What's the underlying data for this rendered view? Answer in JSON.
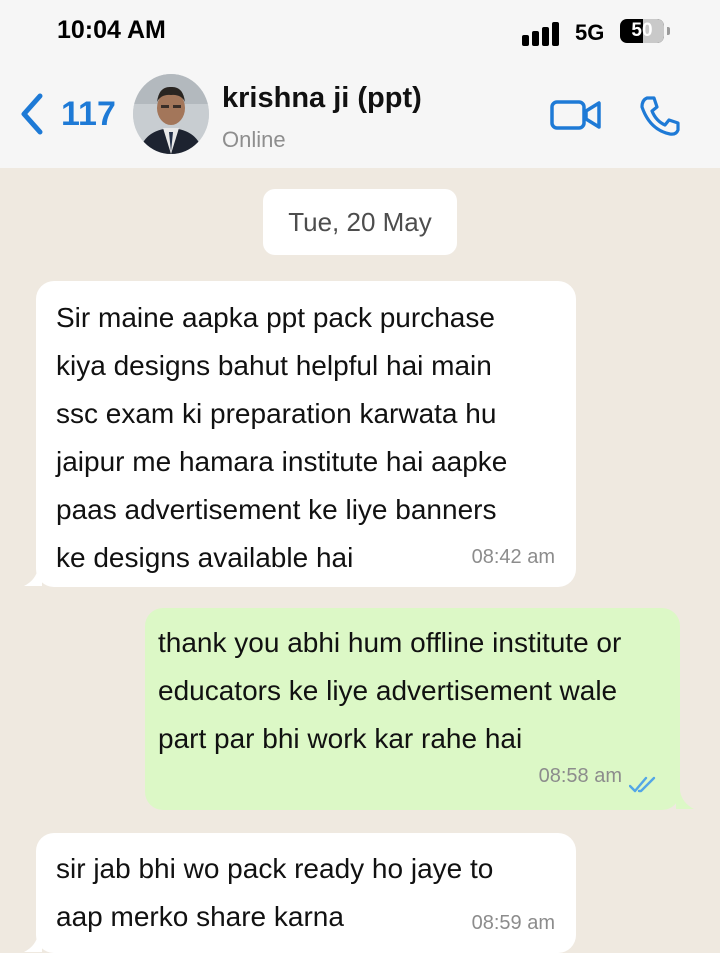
{
  "status_bar": {
    "time": "10:04 AM",
    "network": "5G",
    "battery": "50"
  },
  "header": {
    "back_count": "117",
    "contact_name": "krishna ji (ppt)",
    "contact_status": "Online"
  },
  "chat": {
    "date_chip": "Tue, 20 May",
    "messages": [
      {
        "direction": "incoming",
        "text": "Sir maine aapka ppt pack purchase\nkiya designs bahut helpful hai main\nssc exam ki preparation karwata hu\njaipur me hamara institute hai aapke\npaas advertisement ke liye banners\nke designs available hai",
        "time": "08:42 am"
      },
      {
        "direction": "outgoing",
        "text": "thank you abhi hum offline institute or\neducators ke liye advertisement wale\npart par bhi work kar rahe hai",
        "time": "08:58 am",
        "status_icon": "double-check-read-icon"
      },
      {
        "direction": "incoming",
        "text": "sir jab bhi wo pack ready ho jaye to\naap merko share karna",
        "time": "08:59 am"
      }
    ]
  },
  "colors": {
    "accent": "#1e7ad6",
    "outgoing_bubble": "#dcf8c6",
    "incoming_bubble": "#ffffff",
    "chat_background": "#efe9e0",
    "read_tick": "#53a6e6"
  },
  "icons": [
    "back-chevron-icon",
    "video-call-icon",
    "phone-call-icon",
    "signal-icon",
    "battery-icon"
  ]
}
